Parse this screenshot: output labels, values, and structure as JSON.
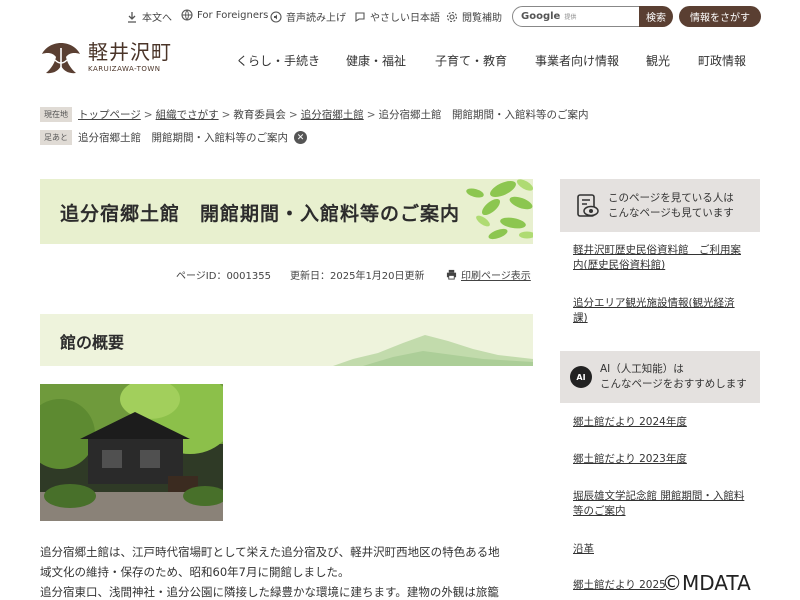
{
  "utility": {
    "text_size": "本文へ",
    "foreigners": "For Foreigners",
    "voice": "音声読み上げ",
    "easy_japanese": "やさしい日本語",
    "reading_aid": "閲覧補助",
    "search_brand": "Google",
    "search_note": "提供",
    "search_button": "検索",
    "info_button": "情報をさがす"
  },
  "logo": {
    "name": "軽井沢町",
    "sub": "KARUIZAWA-TOWN"
  },
  "gnav": [
    "くらし・手続き",
    "健康・福祉",
    "子育て・教育",
    "事業者向け情報",
    "観光",
    "町政情報"
  ],
  "breadcrumb": {
    "tag": "現在地",
    "items": [
      "トップページ",
      "組織でさがす",
      "教育委員会",
      "追分宿郷土館",
      "追分宿郷土館　開館期間・入館料等のご案内"
    ]
  },
  "footprint": {
    "tag": "足あと",
    "text": "追分宿郷土館　開館期間・入館料等のご案内"
  },
  "page": {
    "title": "追分宿郷土館　開館期間・入館料等のご案内",
    "page_id": "ページID：0001355",
    "updated": "更新日：2025年1月20日更新",
    "print": "印刷ページ表示"
  },
  "section": {
    "heading": "館の概要"
  },
  "body": [
    "追分宿郷土館は、江戸時代宿場町として栄えた追分宿及び、軽井沢町西地区の特色ある地",
    "域文化の維持・保存のため、昭和60年7月に開館しました。",
    "追分宿東口、浅間神社・追分公園に隣接した緑豊かな環境に建ちます。建物の外観は旅籠"
  ],
  "sidebar": {
    "box1": [
      "このページを見ている人は",
      "こんなページも見ています"
    ],
    "links1": [
      [
        "軽井沢町歴史民俗資料館　ご利用案",
        "内(歴史民俗資料館)"
      ],
      [
        "追分エリア観光施設情報(観光経済",
        "課)"
      ]
    ],
    "ai_badge": "AI",
    "box2": [
      "AI（人工知能）は",
      "こんなページをおすすめします"
    ],
    "links2": [
      [
        "郷土館だより 2024年度"
      ],
      [
        "郷土館だより 2023年度"
      ],
      [
        "堀辰雄文学記念館 開館期間・入館料",
        "等のご案内"
      ],
      [
        "沿革"
      ],
      [
        "郷土館だより 2025"
      ]
    ]
  },
  "watermark": "©MDATA",
  "colors": {
    "brand_brown": "#5a3f32",
    "banner_green": "#e8f0cf",
    "sidebar_gray": "#e4e1df"
  }
}
